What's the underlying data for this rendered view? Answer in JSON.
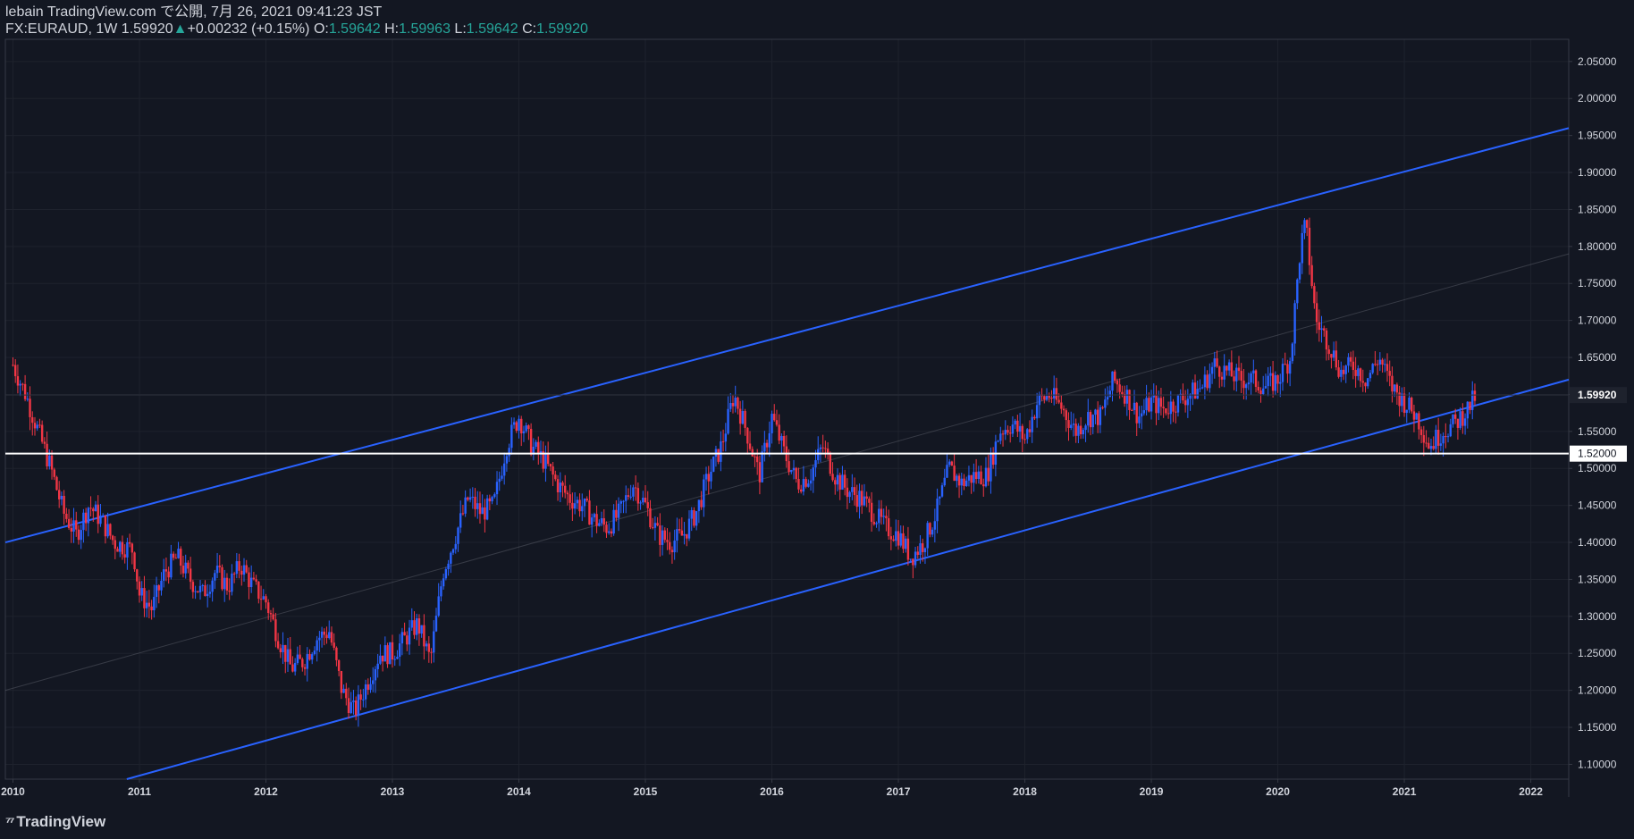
{
  "header": {
    "publish_line": "lebain TradingView.com で公開, 7月 26, 2021 09:41:23 JST",
    "symbol": "FX:EURAUD, 1W",
    "last": "1.59920",
    "change": "+0.00232 (+0.15%)",
    "o_label": "O:",
    "o_val": "1.59642",
    "h_label": "H:",
    "h_val": "1.59963",
    "l_label": "L:",
    "l_val": "1.59642",
    "c_label": "C:",
    "c_val": "1.59920"
  },
  "footer": {
    "brand": "TradingView",
    "logo_icon": "tradingview-logo-icon"
  },
  "colors": {
    "background": "#131722",
    "up": "#2962ff",
    "down": "#f23645",
    "channel": "#2962ff",
    "horizontal": "#ffffff",
    "grid": "#1e222d",
    "axis_text": "#d1d4dc"
  },
  "chart_data": {
    "type": "candlestick",
    "symbol": "FX:EURAUD",
    "interval": "1W",
    "ylim": [
      1.08,
      2.08
    ],
    "y_ticks": [
      1.1,
      1.15,
      1.2,
      1.25,
      1.3,
      1.35,
      1.4,
      1.45,
      1.5,
      1.55,
      1.6,
      1.65,
      1.7,
      1.75,
      1.8,
      1.85,
      1.9,
      1.95,
      2.0,
      2.05
    ],
    "y_tick_labels": [
      "1.10000",
      "1.15000",
      "1.20000",
      "1.25000",
      "1.30000",
      "1.35000",
      "1.40000",
      "1.45000",
      "1.50000",
      "1.55000",
      "1.60000",
      "1.65000",
      "1.70000",
      "1.75000",
      "1.80000",
      "1.85000",
      "1.90000",
      "1.95000",
      "2.00000",
      "2.05000"
    ],
    "xlim": [
      2009.94,
      2022.3
    ],
    "x_ticks": [
      2010,
      2011,
      2012,
      2013,
      2014,
      2015,
      2016,
      2017,
      2018,
      2019,
      2020,
      2021,
      2022
    ],
    "x_tick_labels": [
      "2010",
      "2011",
      "2012",
      "2013",
      "2014",
      "2015",
      "2016",
      "2017",
      "2018",
      "2019",
      "2020",
      "2021",
      "2022"
    ],
    "last_price_label": "1.59920",
    "horizontal_level_label": "1.52000",
    "horizontal_level": 1.52,
    "channel": {
      "upper": [
        [
          2009.94,
          1.4
        ],
        [
          2022.3,
          1.96
        ]
      ],
      "lower": [
        [
          2010.9,
          1.08
        ],
        [
          2022.3,
          1.62
        ]
      ],
      "mid": [
        [
          2009.94,
          1.2
        ],
        [
          2022.3,
          1.79
        ]
      ]
    },
    "price_path": [
      [
        2010.0,
        1.64
      ],
      [
        2010.1,
        1.6
      ],
      [
        2010.2,
        1.55
      ],
      [
        2010.3,
        1.5
      ],
      [
        2010.4,
        1.44
      ],
      [
        2010.5,
        1.41
      ],
      [
        2010.6,
        1.45
      ],
      [
        2010.7,
        1.43
      ],
      [
        2010.8,
        1.4
      ],
      [
        2010.95,
        1.39
      ],
      [
        2011.0,
        1.33
      ],
      [
        2011.1,
        1.31
      ],
      [
        2011.2,
        1.36
      ],
      [
        2011.3,
        1.38
      ],
      [
        2011.4,
        1.35
      ],
      [
        2011.5,
        1.33
      ],
      [
        2011.6,
        1.36
      ],
      [
        2011.7,
        1.34
      ],
      [
        2011.8,
        1.37
      ],
      [
        2011.9,
        1.34
      ],
      [
        2012.0,
        1.32
      ],
      [
        2012.1,
        1.27
      ],
      [
        2012.2,
        1.23
      ],
      [
        2012.3,
        1.24
      ],
      [
        2012.4,
        1.27
      ],
      [
        2012.5,
        1.28
      ],
      [
        2012.6,
        1.2
      ],
      [
        2012.7,
        1.17
      ],
      [
        2012.8,
        1.21
      ],
      [
        2012.9,
        1.25
      ],
      [
        2013.0,
        1.25
      ],
      [
        2013.1,
        1.27
      ],
      [
        2013.2,
        1.29
      ],
      [
        2013.3,
        1.24
      ],
      [
        2013.4,
        1.36
      ],
      [
        2013.5,
        1.41
      ],
      [
        2013.6,
        1.46
      ],
      [
        2013.7,
        1.44
      ],
      [
        2013.8,
        1.45
      ],
      [
        2013.9,
        1.53
      ],
      [
        2014.0,
        1.57
      ],
      [
        2014.1,
        1.53
      ],
      [
        2014.2,
        1.51
      ],
      [
        2014.3,
        1.48
      ],
      [
        2014.4,
        1.46
      ],
      [
        2014.5,
        1.45
      ],
      [
        2014.6,
        1.43
      ],
      [
        2014.7,
        1.42
      ],
      [
        2014.8,
        1.44
      ],
      [
        2014.9,
        1.48
      ],
      [
        2015.0,
        1.45
      ],
      [
        2015.1,
        1.41
      ],
      [
        2015.2,
        1.4
      ],
      [
        2015.3,
        1.41
      ],
      [
        2015.4,
        1.44
      ],
      [
        2015.5,
        1.49
      ],
      [
        2015.6,
        1.53
      ],
      [
        2015.7,
        1.6
      ],
      [
        2015.8,
        1.55
      ],
      [
        2015.9,
        1.49
      ],
      [
        2016.0,
        1.57
      ],
      [
        2016.1,
        1.52
      ],
      [
        2016.2,
        1.48
      ],
      [
        2016.3,
        1.49
      ],
      [
        2016.4,
        1.53
      ],
      [
        2016.5,
        1.49
      ],
      [
        2016.6,
        1.47
      ],
      [
        2016.7,
        1.46
      ],
      [
        2016.8,
        1.44
      ],
      [
        2016.9,
        1.42
      ],
      [
        2017.0,
        1.41
      ],
      [
        2017.1,
        1.38
      ],
      [
        2017.2,
        1.4
      ],
      [
        2017.3,
        1.44
      ],
      [
        2017.4,
        1.5
      ],
      [
        2017.5,
        1.48
      ],
      [
        2017.6,
        1.49
      ],
      [
        2017.7,
        1.49
      ],
      [
        2017.8,
        1.55
      ],
      [
        2017.9,
        1.56
      ],
      [
        2018.0,
        1.54
      ],
      [
        2018.1,
        1.59
      ],
      [
        2018.2,
        1.6
      ],
      [
        2018.3,
        1.58
      ],
      [
        2018.4,
        1.55
      ],
      [
        2018.5,
        1.57
      ],
      [
        2018.6,
        1.57
      ],
      [
        2018.7,
        1.62
      ],
      [
        2018.8,
        1.6
      ],
      [
        2018.9,
        1.57
      ],
      [
        2019.0,
        1.59
      ],
      [
        2019.1,
        1.58
      ],
      [
        2019.2,
        1.59
      ],
      [
        2019.3,
        1.6
      ],
      [
        2019.4,
        1.61
      ],
      [
        2019.5,
        1.64
      ],
      [
        2019.6,
        1.63
      ],
      [
        2019.7,
        1.62
      ],
      [
        2019.8,
        1.62
      ],
      [
        2019.9,
        1.61
      ],
      [
        2020.0,
        1.62
      ],
      [
        2020.1,
        1.65
      ],
      [
        2020.18,
        1.8
      ],
      [
        2020.22,
        1.83
      ],
      [
        2020.3,
        1.7
      ],
      [
        2020.4,
        1.67
      ],
      [
        2020.5,
        1.63
      ],
      [
        2020.6,
        1.64
      ],
      [
        2020.7,
        1.62
      ],
      [
        2020.8,
        1.65
      ],
      [
        2020.9,
        1.61
      ],
      [
        2021.0,
        1.59
      ],
      [
        2021.1,
        1.57
      ],
      [
        2021.2,
        1.53
      ],
      [
        2021.3,
        1.55
      ],
      [
        2021.4,
        1.56
      ],
      [
        2021.5,
        1.58
      ],
      [
        2021.57,
        1.599
      ]
    ]
  }
}
